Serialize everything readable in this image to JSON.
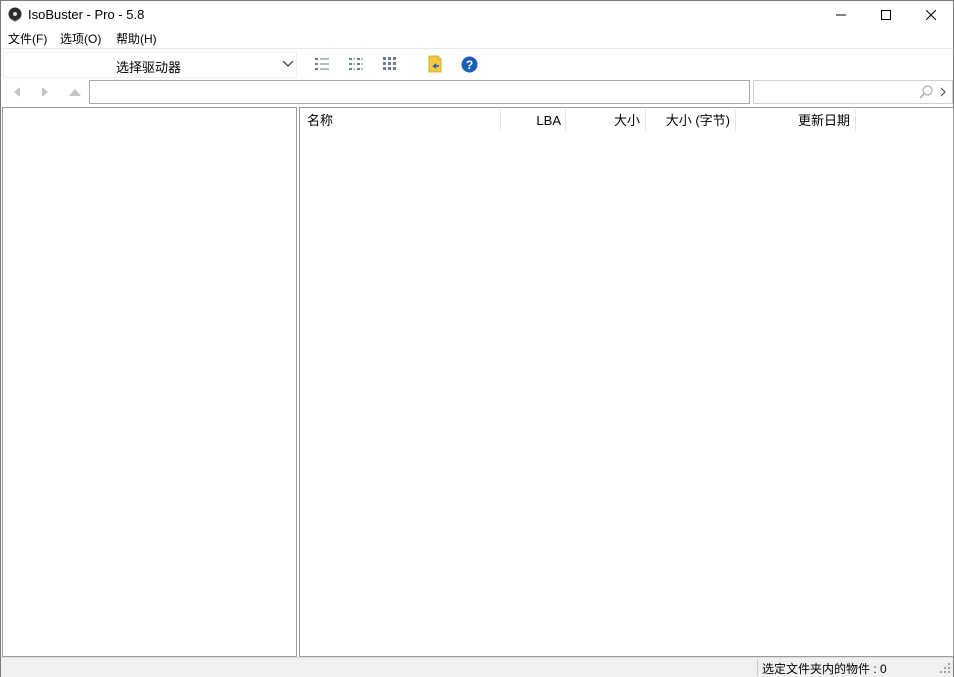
{
  "window": {
    "title": "IsoBuster - Pro - 5.8"
  },
  "menu": {
    "items": [
      {
        "label": "文件(F)"
      },
      {
        "label": "选项(O)"
      },
      {
        "label": "帮助(H)"
      }
    ]
  },
  "toolbar": {
    "drive_select": "选择驱动器",
    "icons": [
      "details-view-icon",
      "list-view-icon",
      "icons-view-icon",
      "extract-folder-icon",
      "help-icon"
    ]
  },
  "address": {
    "path_value": "",
    "search_value": ""
  },
  "list": {
    "columns": [
      {
        "label": "名称"
      },
      {
        "label": "LBA"
      },
      {
        "label": "大小"
      },
      {
        "label": "大小 (字节)"
      },
      {
        "label": "更新日期"
      }
    ],
    "rows": []
  },
  "status": {
    "text": "选定文件夹内的物件 : 0"
  },
  "colors": {
    "help_blue": "#1a5fb4",
    "folder_yellow": "#f5c842",
    "refresh_blue": "#2a7fd4"
  }
}
